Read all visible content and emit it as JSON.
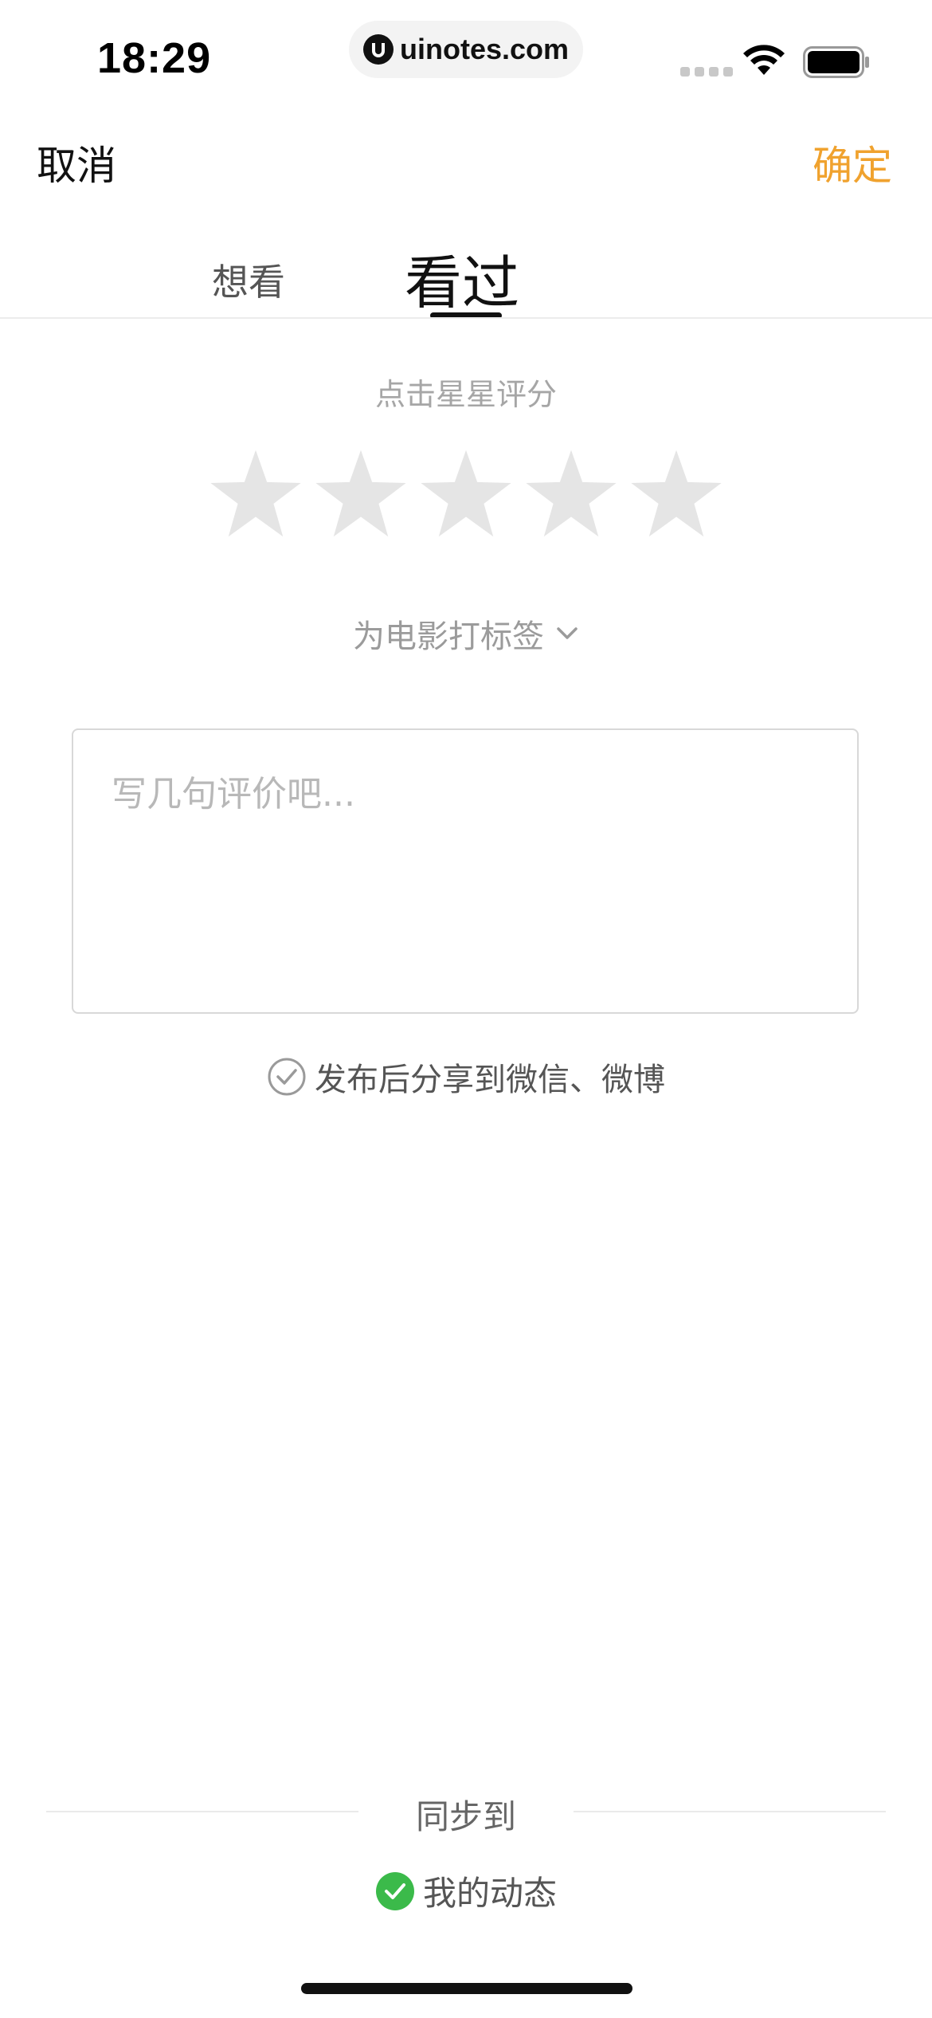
{
  "status_bar": {
    "time": "18:29",
    "url": "uinotes.com",
    "wifi_icon": "wifi-icon",
    "battery_icon": "battery-icon"
  },
  "nav": {
    "cancel_label": "取消",
    "confirm_label": "确定",
    "confirm_color": "#f0a22e"
  },
  "tabs": {
    "want_label": "想看",
    "watched_label": "看过",
    "selected": "看过"
  },
  "rating": {
    "hint": "点击星星评分",
    "max_stars": 5,
    "value": 0,
    "star_color_empty": "#e5e5e5"
  },
  "tag": {
    "label": "为电影打标签",
    "icon": "chevron-down-icon"
  },
  "review": {
    "placeholder": "写几句评价吧...",
    "value": ""
  },
  "share": {
    "label": "发布后分享到微信、微博",
    "checked": false,
    "icon": "check-circle-outline-icon"
  },
  "sync": {
    "title": "同步到",
    "option_label": "我的动态",
    "option_checked": true,
    "check_color": "#3bba4a"
  }
}
